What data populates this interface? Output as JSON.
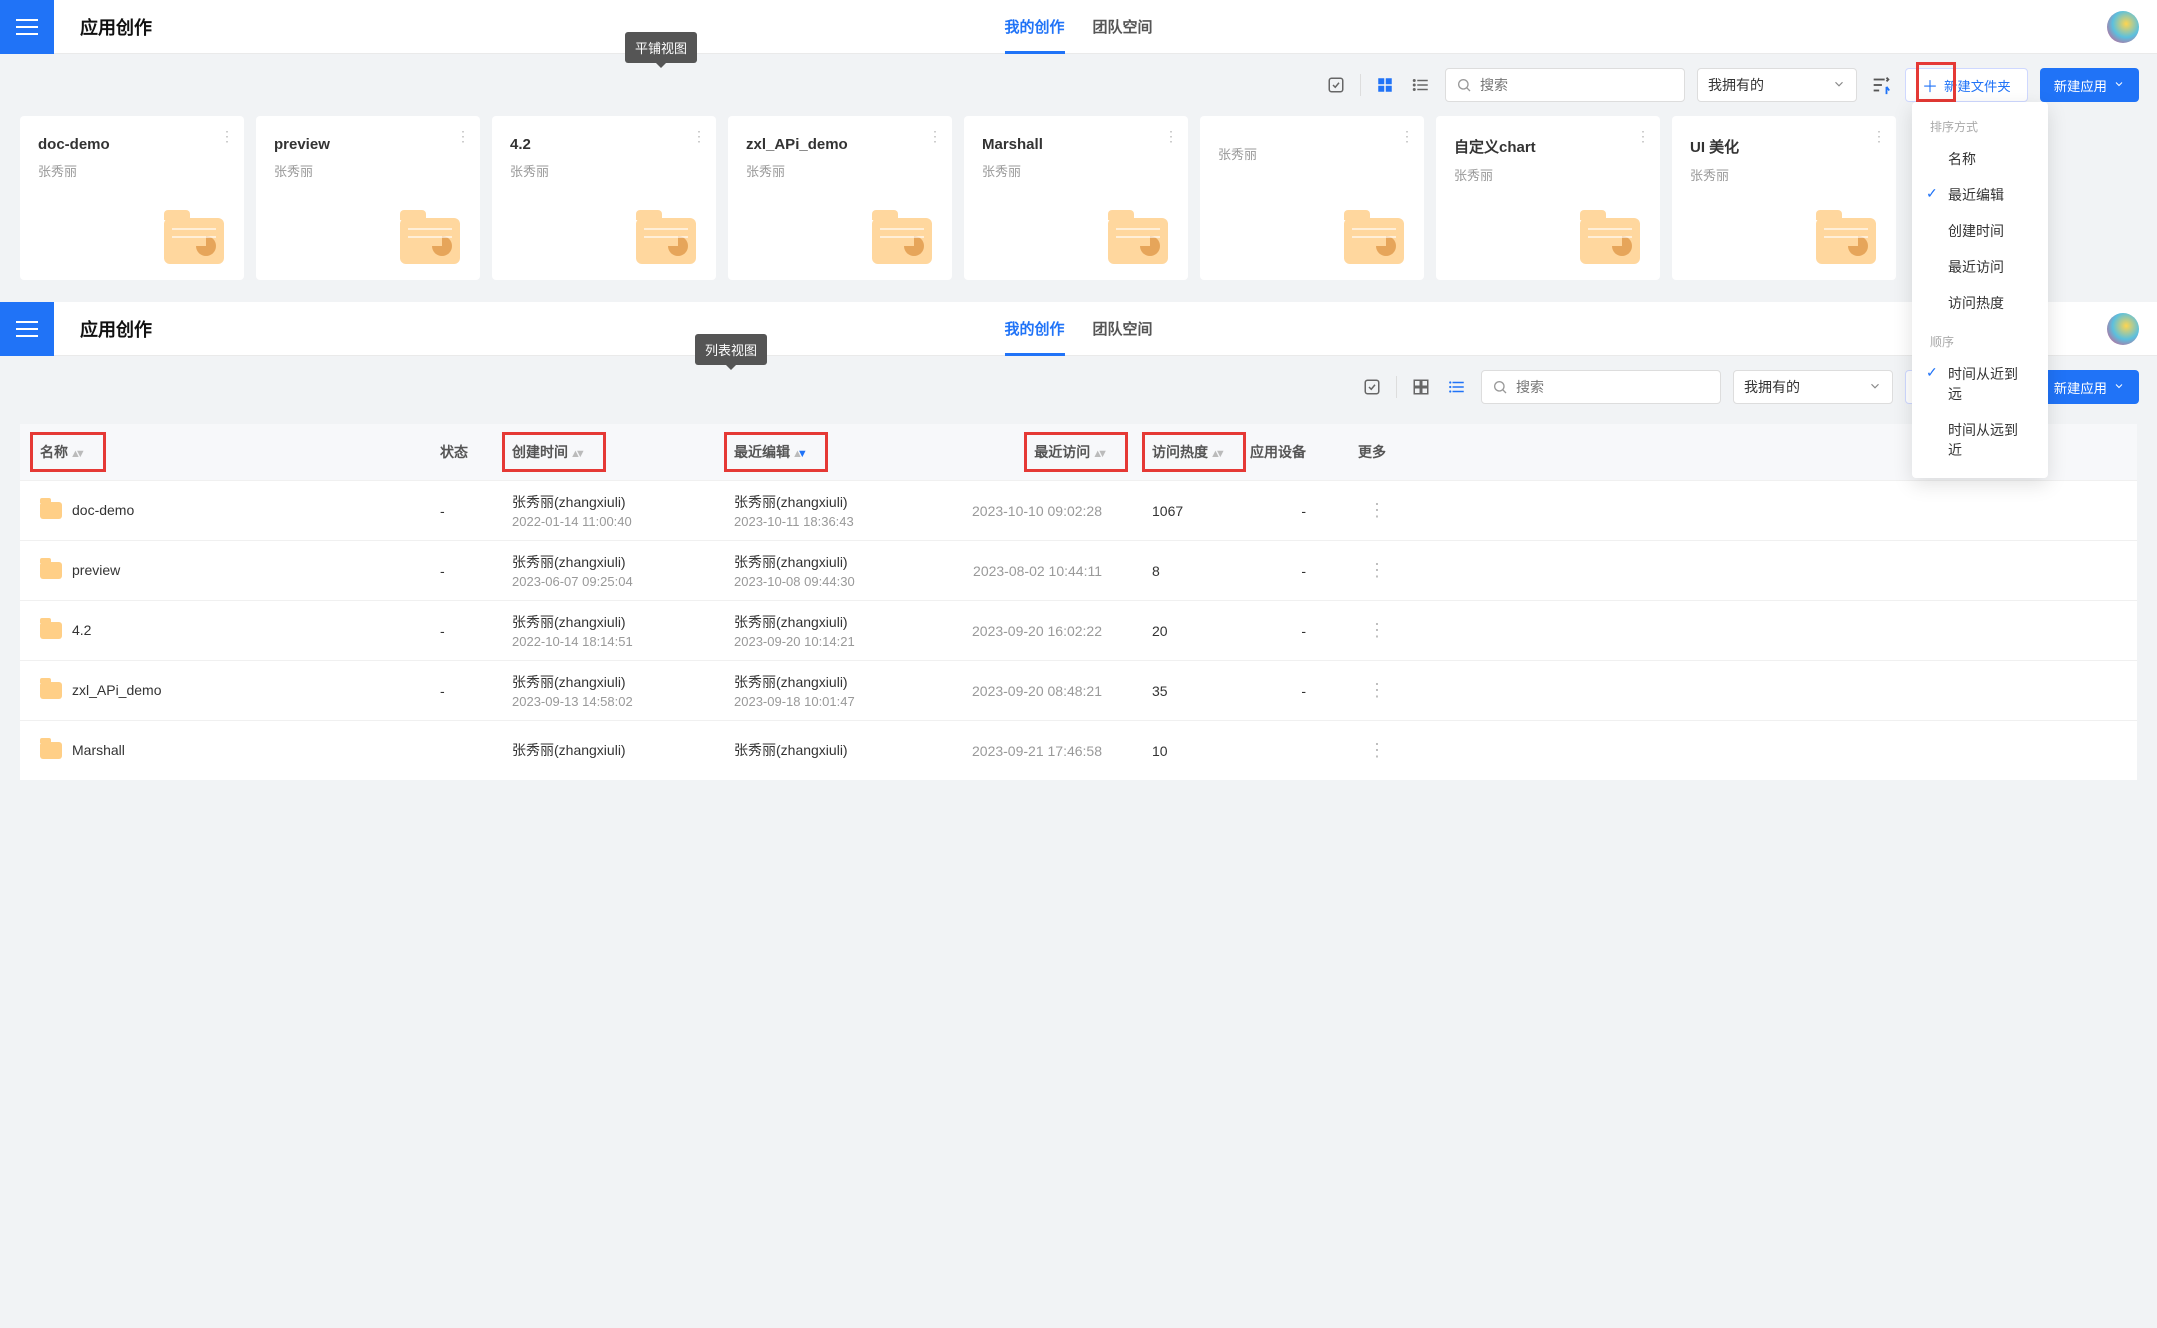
{
  "app_title": "应用创作",
  "tabs": {
    "mine": "我的创作",
    "team": "团队空间"
  },
  "tooltips": {
    "grid": "平铺视图",
    "list": "列表视图"
  },
  "search_placeholder": "搜索",
  "filter_selected": "我拥有的",
  "btn_new_folder": "新建文件夹",
  "btn_new_app": "新建应用",
  "sort_panel": {
    "heading_method": "排序方式",
    "options": [
      "名称",
      "最近编辑",
      "创建时间",
      "最近访问",
      "访问热度"
    ],
    "selected_method": "最近编辑",
    "heading_order": "顺序",
    "orders": [
      "时间从近到远",
      "时间从远到近"
    ],
    "selected_order": "时间从近到远"
  },
  "owner": "张秀丽",
  "cards": [
    {
      "name": "doc-demo"
    },
    {
      "name": "preview"
    },
    {
      "name": "4.2"
    },
    {
      "name": "zxl_APi_demo"
    },
    {
      "name": "Marshall"
    },
    {
      "name": ""
    },
    {
      "name": "自定义chart"
    },
    {
      "name": "UI 美化"
    }
  ],
  "columns": {
    "name": "名称",
    "state": "状态",
    "create": "创建时间",
    "lastedit": "最近编辑",
    "lastaccess": "最近访问",
    "hot": "访问热度",
    "device": "应用设备",
    "more": "更多"
  },
  "rows": [
    {
      "name": "doc-demo",
      "state": "-",
      "created_by": "张秀丽(zhangxiuli)",
      "created_at": "2022-01-14 11:00:40",
      "edited_by": "张秀丽(zhangxiuli)",
      "edited_at": "2023-10-11 18:36:43",
      "access_at": "2023-10-10 09:02:28",
      "hot": "1067",
      "device": "-"
    },
    {
      "name": "preview",
      "state": "-",
      "created_by": "张秀丽(zhangxiuli)",
      "created_at": "2023-06-07 09:25:04",
      "edited_by": "张秀丽(zhangxiuli)",
      "edited_at": "2023-10-08 09:44:30",
      "access_at": "2023-08-02 10:44:11",
      "hot": "8",
      "device": "-"
    },
    {
      "name": "4.2",
      "state": "-",
      "created_by": "张秀丽(zhangxiuli)",
      "created_at": "2022-10-14 18:14:51",
      "edited_by": "张秀丽(zhangxiuli)",
      "edited_at": "2023-09-20 10:14:21",
      "access_at": "2023-09-20 16:02:22",
      "hot": "20",
      "device": "-"
    },
    {
      "name": "zxl_APi_demo",
      "state": "-",
      "created_by": "张秀丽(zhangxiuli)",
      "created_at": "2023-09-13 14:58:02",
      "edited_by": "张秀丽(zhangxiuli)",
      "edited_at": "2023-09-18 10:01:47",
      "access_at": "2023-09-20 08:48:21",
      "hot": "35",
      "device": "-"
    },
    {
      "name": "Marshall",
      "state": "",
      "created_by": "张秀丽(zhangxiuli)",
      "created_at": "",
      "edited_by": "张秀丽(zhangxiuli)",
      "edited_at": "",
      "access_at": "2023-09-21 17:46:58",
      "hot": "10",
      "device": ""
    }
  ]
}
